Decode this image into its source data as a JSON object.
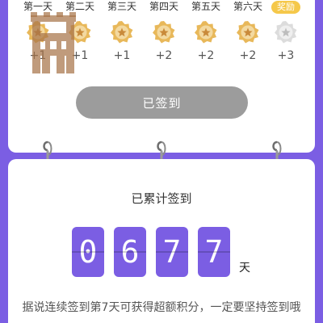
{
  "days": [
    {
      "label": "第一天",
      "points": "+1",
      "medal": "gold-medal-icon",
      "state": "signed"
    },
    {
      "label": "第二天",
      "points": "+1",
      "medal": "gold-medal-icon",
      "state": "signed"
    },
    {
      "label": "第三天",
      "points": "+1",
      "medal": "gold-medal-icon",
      "state": "signed"
    },
    {
      "label": "第四天",
      "points": "+2",
      "medal": "gold-medal-icon",
      "state": "signed"
    },
    {
      "label": "第五天",
      "points": "+2",
      "medal": "gold-medal-icon",
      "state": "signed"
    },
    {
      "label": "第六天",
      "points": "+2",
      "medal": "gold-medal-icon",
      "state": "signed"
    },
    {
      "label": "奖励",
      "points": "+3",
      "medal": "silver-medal-icon",
      "state": "reward"
    }
  ],
  "sign_button": {
    "label": "已签到"
  },
  "total": {
    "title": "已累计签到",
    "digits": [
      "0",
      "6",
      "7",
      "7"
    ],
    "unit": "天"
  },
  "tip": "据说连续签到第7天可获得超额积分，一定要坚持签到哦",
  "colors": {
    "background": "#7b5ee3",
    "digit_tile": "#7b5ee3",
    "gold": "#e8b85a",
    "silver": "#d8d8d8",
    "reward_badge": "#f5c84a",
    "signed_button": "#9c9c9c"
  }
}
